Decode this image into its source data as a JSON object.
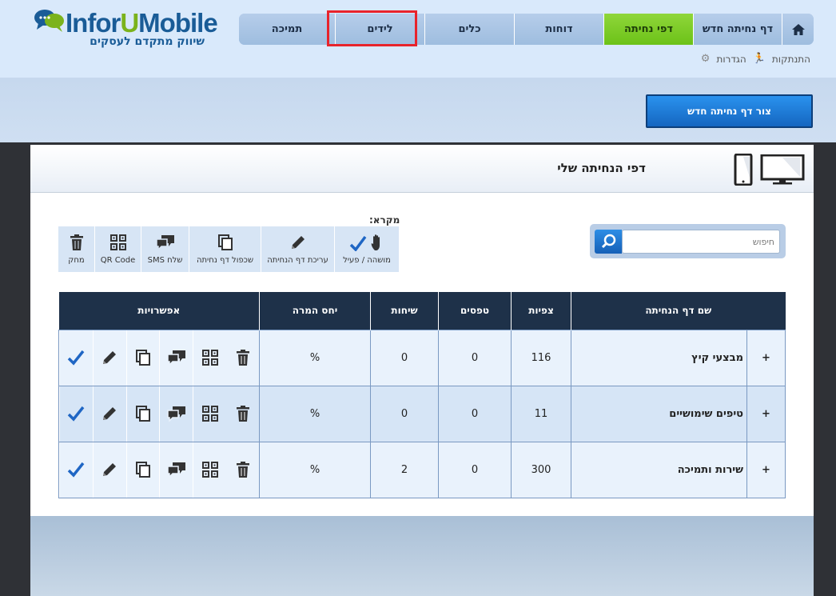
{
  "brand": {
    "logo_text": "InforUMobile",
    "tagline": "שיווק מתקדם לעסקים"
  },
  "nav": {
    "items": [
      {
        "label": "דף נחיתה חדש"
      },
      {
        "label": "דפי נחיתה",
        "active": true
      },
      {
        "label": "דוחות"
      },
      {
        "label": "כלים"
      },
      {
        "label": "לידים",
        "highlighted": true
      },
      {
        "label": "תמיכה"
      }
    ],
    "settings": "הגדרות",
    "logout": "התנתקות"
  },
  "create_button": "צור דף נחיתה חדש",
  "panel": {
    "title": "דפי הנחיתה שלי"
  },
  "search": {
    "placeholder": "חיפוש"
  },
  "legend": {
    "title": "מקרא:",
    "items": [
      {
        "icon": "hand-check-icon",
        "label": "מושהה / פעיל"
      },
      {
        "icon": "pencil-icon",
        "label": "עריכת דף הנחיתה"
      },
      {
        "icon": "copy-icon",
        "label": "שכפול דף נחיתה"
      },
      {
        "icon": "chat-icon",
        "label": "שלח SMS"
      },
      {
        "icon": "qr-icon",
        "label": "QR Code"
      },
      {
        "icon": "trash-icon",
        "label": "מחק"
      }
    ]
  },
  "table": {
    "headers": {
      "name": "שם דף הנחיתה",
      "views": "צפיות",
      "forms": "טפסים",
      "calls": "שיחות",
      "conversion": "יחס המרה",
      "options": "אפשרויות"
    },
    "rows": [
      {
        "name": "מבצעי קיץ",
        "views": "116",
        "forms": "0",
        "calls": "0",
        "conversion": "%"
      },
      {
        "name": "טיפים שימושיים",
        "views": "11",
        "forms": "0",
        "calls": "0",
        "conversion": "%"
      },
      {
        "name": "שירות ותמיכה",
        "views": "300",
        "forms": "0",
        "calls": "2",
        "conversion": "%"
      }
    ]
  },
  "colors": {
    "accent_green": "#6cc218",
    "header_navy": "#1e3149",
    "button_blue": "#1566c0",
    "highlight_red": "#e8232b"
  }
}
